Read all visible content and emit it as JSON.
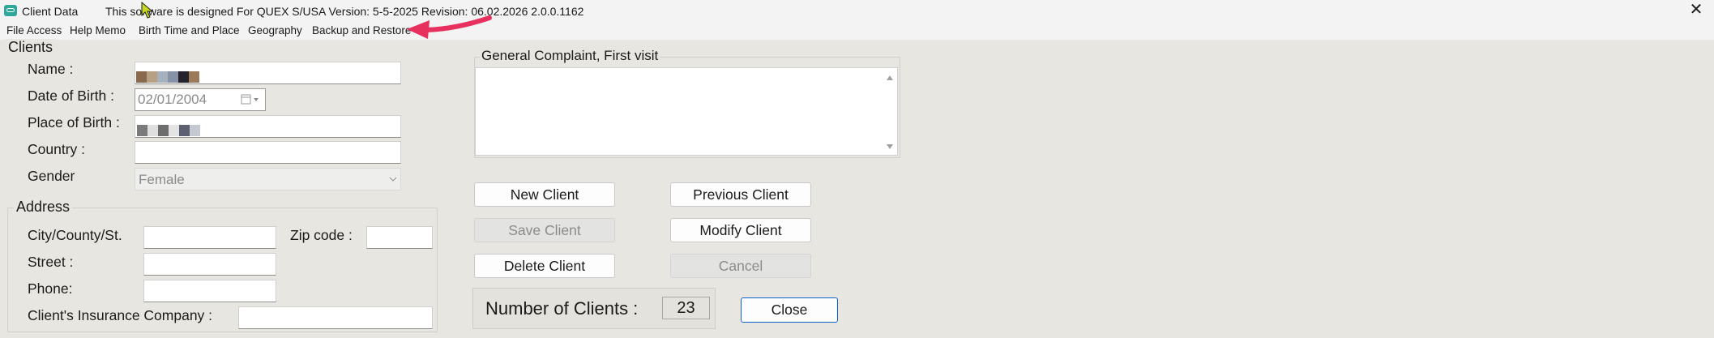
{
  "window": {
    "title": "Client Data",
    "subtitle": "This software is designed For QUEX S/USA Version: 5-5-2025 Revision: 06.02.2026 2.0.0.1162",
    "close_glyph": "✕"
  },
  "menu": [
    "File Access",
    "Help Memo",
    "Birth Time and Place",
    "Geography",
    "Backup and Restore"
  ],
  "clients_group": {
    "title": "Clients",
    "name_label": "Name :",
    "dob_label": "Date of Birth :",
    "dob_value": "02/01/2004",
    "pob_label": "Place of Birth :",
    "country_label": "Country :",
    "gender_label": "Gender",
    "gender_value": "Female"
  },
  "address_group": {
    "title": "Address",
    "city_label": "City/County/St.",
    "zip_label": "Zip code :",
    "street_label": "Street :",
    "phone_label": "Phone:",
    "insurance_label": "Client's Insurance Company :"
  },
  "complaint": {
    "title": "General Complaint, First visit"
  },
  "buttons": {
    "new_client": "New Client",
    "previous_client": "Previous Client",
    "save_client": "Save Client",
    "modify_client": "Modify Client",
    "delete_client": "Delete Client",
    "cancel": "Cancel",
    "close": "Close"
  },
  "count": {
    "label": "Number of Clients :",
    "value": "23"
  },
  "colors": {
    "accent_arrow": "#e8305f",
    "background": "#e8e6e0",
    "close_border": "#0a64c8"
  },
  "icons": [
    "app-icon",
    "close-icon",
    "cursor-icon",
    "arrow-annotation-icon",
    "calendar-icon",
    "chevron-down-icon",
    "scroll-up-icon",
    "scroll-down-icon"
  ]
}
